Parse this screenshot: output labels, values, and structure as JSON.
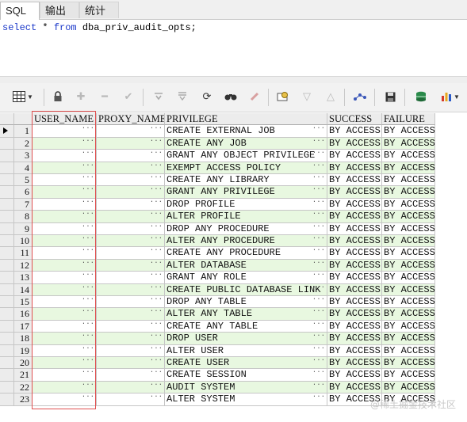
{
  "tabs": [
    {
      "label": "SQL",
      "active": true
    },
    {
      "label": "输出",
      "active": false
    },
    {
      "label": "统计",
      "active": false
    }
  ],
  "editor": {
    "kw_select": "select",
    "star": " * ",
    "kw_from": "from",
    "rest": " dba_priv_audit_opts;"
  },
  "toolbar": {
    "icons": [
      "grid-view-icon",
      "lock-icon",
      "add-row-icon",
      "delete-row-icon",
      "post-icon",
      "first-record-icon",
      "last-record-icon",
      "refresh-icon",
      "find-icon",
      "clear-icon",
      "query-by-example-icon",
      "next-page-icon",
      "previous-page-icon",
      "connect-icon",
      "save-icon",
      "export-icon",
      "chart-icon"
    ]
  },
  "grid": {
    "columns": [
      "USER_NAME",
      "PROXY_NAME",
      "PRIVILEGE",
      "SUCCESS",
      "FAILURE"
    ],
    "ellipsis": "···",
    "rows": [
      {
        "n": "1",
        "privilege": "CREATE EXTERNAL JOB",
        "success": "BY ACCESS",
        "failure": "BY ACCESS"
      },
      {
        "n": "2",
        "privilege": "CREATE ANY JOB",
        "success": "BY ACCESS",
        "failure": "BY ACCESS"
      },
      {
        "n": "3",
        "privilege": "GRANT ANY OBJECT PRIVILEGE",
        "success": "BY ACCESS",
        "failure": "BY ACCESS"
      },
      {
        "n": "4",
        "privilege": "EXEMPT ACCESS POLICY",
        "success": "BY ACCESS",
        "failure": "BY ACCESS"
      },
      {
        "n": "5",
        "privilege": "CREATE ANY LIBRARY",
        "success": "BY ACCESS",
        "failure": "BY ACCESS"
      },
      {
        "n": "6",
        "privilege": "GRANT ANY PRIVILEGE",
        "success": "BY ACCESS",
        "failure": "BY ACCESS"
      },
      {
        "n": "7",
        "privilege": "DROP PROFILE",
        "success": "BY ACCESS",
        "failure": "BY ACCESS"
      },
      {
        "n": "8",
        "privilege": "ALTER PROFILE",
        "success": "BY ACCESS",
        "failure": "BY ACCESS"
      },
      {
        "n": "9",
        "privilege": "DROP ANY PROCEDURE",
        "success": "BY ACCESS",
        "failure": "BY ACCESS"
      },
      {
        "n": "10",
        "privilege": "ALTER ANY PROCEDURE",
        "success": "BY ACCESS",
        "failure": "BY ACCESS"
      },
      {
        "n": "11",
        "privilege": "CREATE ANY PROCEDURE",
        "success": "BY ACCESS",
        "failure": "BY ACCESS"
      },
      {
        "n": "12",
        "privilege": "ALTER DATABASE",
        "success": "BY ACCESS",
        "failure": "BY ACCESS"
      },
      {
        "n": "13",
        "privilege": "GRANT ANY ROLE",
        "success": "BY ACCESS",
        "failure": "BY ACCESS"
      },
      {
        "n": "14",
        "privilege": "CREATE PUBLIC DATABASE LINK",
        "success": "BY ACCESS",
        "failure": "BY ACCESS"
      },
      {
        "n": "15",
        "privilege": "DROP ANY TABLE",
        "success": "BY ACCESS",
        "failure": "BY ACCESS"
      },
      {
        "n": "16",
        "privilege": "ALTER ANY TABLE",
        "success": "BY ACCESS",
        "failure": "BY ACCESS"
      },
      {
        "n": "17",
        "privilege": "CREATE ANY TABLE",
        "success": "BY ACCESS",
        "failure": "BY ACCESS"
      },
      {
        "n": "18",
        "privilege": "DROP USER",
        "success": "BY ACCESS",
        "failure": "BY ACCESS"
      },
      {
        "n": "19",
        "privilege": "ALTER USER",
        "success": "BY ACCESS",
        "failure": "BY ACCESS"
      },
      {
        "n": "20",
        "privilege": "CREATE USER",
        "success": "BY ACCESS",
        "failure": "BY ACCESS"
      },
      {
        "n": "21",
        "privilege": "CREATE SESSION",
        "success": "BY ACCESS",
        "failure": "BY ACCESS"
      },
      {
        "n": "22",
        "privilege": "AUDIT SYSTEM",
        "success": "BY ACCESS",
        "failure": "BY ACCESS"
      },
      {
        "n": "23",
        "privilege": "ALTER SYSTEM",
        "success": "BY ACCESS",
        "failure": "BY ACCESS"
      }
    ]
  },
  "colors": {
    "row_green": "#e8f8e0",
    "highlight": "#e05050",
    "keyword": "#1a37c9"
  },
  "watermark": "@稀土掘金技术社区"
}
